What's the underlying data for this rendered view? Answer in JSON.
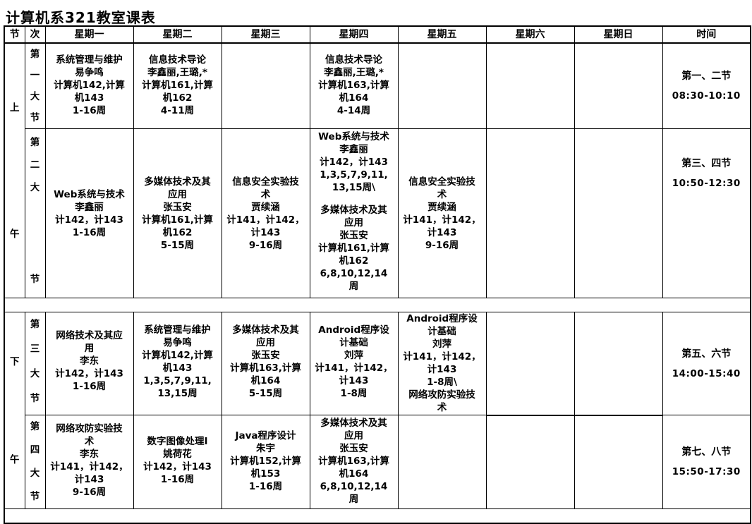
{
  "title": "计算机系321教室课表",
  "header": [
    "节",
    "次",
    "星期一",
    "星期二",
    "星期三",
    "星期四",
    "星期五",
    "星期六",
    "星期日",
    "时间"
  ],
  "morning_label": [
    "上",
    "午"
  ],
  "afternoon_label": [
    "下",
    "午"
  ],
  "periods": [
    {
      "chars": [
        "第",
        "一",
        "大",
        "节"
      ],
      "time_name": "第一、二节",
      "time": "08:30-10:10"
    },
    {
      "chars": [
        "第",
        "二",
        "大",
        "节"
      ],
      "time_name": "第三、四节",
      "time": "10:50-12:30"
    },
    {
      "chars": [
        "第",
        "三",
        "大",
        "节"
      ],
      "time_name": "第五、六节",
      "time": "14:00-15:40"
    },
    {
      "chars": [
        "第",
        "四",
        "大",
        "节"
      ],
      "time_name": "第七、八节",
      "time": "15:50-17:30"
    }
  ],
  "cells": {
    "p1": {
      "mon": [
        "系统管理与维护",
        "易争鸣",
        "计算机142,计算",
        "机143",
        "1-16周"
      ],
      "tue": [
        "信息技术导论",
        "李鑫丽,王璐,*",
        "计算机161,计算",
        "机162",
        "4-11周"
      ],
      "wed": [],
      "thu": [
        "信息技术导论",
        "李鑫丽,王璐,*",
        "计算机163,计算",
        "机164",
        "4-14周"
      ],
      "fri": []
    },
    "p2": {
      "mon": [
        "Web系统与技术",
        "李鑫丽",
        "计142，计143",
        "1-16周"
      ],
      "tue": [
        "多媒体技术及其",
        "应用",
        "张玉安",
        "计算机161,计算",
        "机162",
        "5-15周"
      ],
      "wed": [
        "信息安全实验技",
        "术",
        "贾续涵",
        "计141，计142，",
        "计143",
        "9-16周"
      ],
      "thu_a": [
        "Web系统与技术",
        "李鑫丽",
        "计142，计143",
        "1,3,5,7,9,11,",
        "13,15周\\"
      ],
      "thu_b": [
        "多媒体技术及其",
        "应用",
        "张玉安",
        "计算机161,计算",
        "机162",
        "6,8,10,12,14",
        "周"
      ],
      "fri": [
        "信息安全实验技",
        "术",
        "贾续涵",
        "计141，计142，",
        "计143",
        "9-16周"
      ]
    },
    "p3": {
      "mon": [
        "网络技术及其应",
        "用",
        "李东",
        "计142，计143",
        "1-16周"
      ],
      "tue": [
        "系统管理与维护",
        "易争鸣",
        "计算机142,计算",
        "机143",
        "1,3,5,7,9,11,",
        "13,15周"
      ],
      "wed": [
        "多媒体技术及其",
        "应用",
        "张玉安",
        "计算机163,计算",
        "机164",
        "5-15周"
      ],
      "thu": [
        "Android程序设",
        "计基础",
        "刘萍",
        "计141，计142，",
        "计143",
        "1-8周"
      ],
      "fri": [
        "Android程序设",
        "计基础",
        "刘萍",
        "计141，计142，",
        "计143",
        "1-8周\\",
        "网络攻防实验技",
        "术"
      ]
    },
    "p4": {
      "mon": [
        "网络攻防实验技",
        "术",
        "李东",
        "计141，计142，",
        "计143",
        "9-16周"
      ],
      "tue": [
        "数字图像处理I",
        "姚荷花",
        "计142，计143",
        "1-16周"
      ],
      "wed": [
        "Java程序设计",
        "朱宇",
        "计算机152,计算",
        "机153",
        "1-16周"
      ],
      "thu": [
        "多媒体技术及其",
        "应用",
        "张玉安",
        "计算机163,计算",
        "机164",
        "6,8,10,12,14",
        "周"
      ],
      "fri": []
    }
  }
}
